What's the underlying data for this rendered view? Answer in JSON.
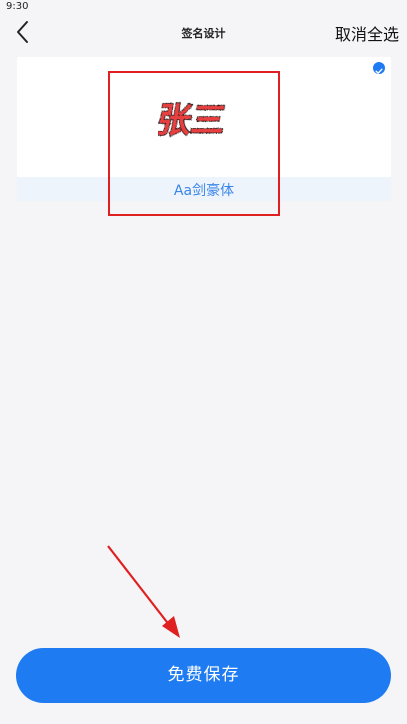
{
  "status_bar": {
    "time": "9:30"
  },
  "header": {
    "title": "签名设计",
    "deselect_all": "取消全选",
    "back_icon": "chevron-left-icon"
  },
  "signature_card": {
    "preview_text": "张三",
    "font_label": "Aa剑豪体",
    "selected": true,
    "check_icon": "check-circle-icon",
    "accent_color": "#1e7bf2"
  },
  "footer": {
    "save_label": "免费保存"
  },
  "annotations": {
    "highlight_color": "#e02020"
  }
}
